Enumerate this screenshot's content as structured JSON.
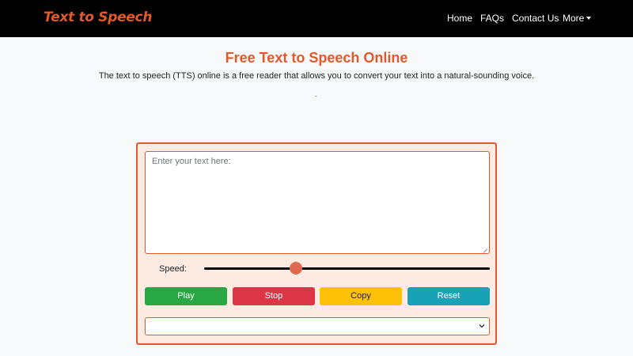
{
  "navbar": {
    "brand": "Text to Speech",
    "items": [
      {
        "label": "Home"
      },
      {
        "label": "FAQs"
      },
      {
        "label": "Contact Us"
      },
      {
        "label": "More"
      }
    ]
  },
  "main": {
    "title": "Free Text to Speech Online",
    "subtitle": "The text to speech (TTS) online is a free reader that allows you to convert your text into a natural-sounding voice.",
    "dot": "-"
  },
  "tool": {
    "textarea_placeholder": "Enter your text here:",
    "textarea_value": "",
    "speed_label": "Speed:",
    "speed_level_fraction": 0.32,
    "buttons": {
      "play": "Play",
      "stop": "Stop",
      "copy": "Copy",
      "reset": "Reset"
    },
    "voice_select_value": ""
  },
  "colors": {
    "brand": "#e0592a",
    "navbar_bg": "#000000",
    "panel_bg": "#fcebe3",
    "play": "#28a745",
    "stop": "#dc3545",
    "copy": "#ffc107",
    "reset": "#17a2b8",
    "slider_thumb": "#e06a4d"
  },
  "icons": {
    "more_dropdown": "caret-down-icon",
    "select_dropdown": "chevron-down-icon"
  }
}
